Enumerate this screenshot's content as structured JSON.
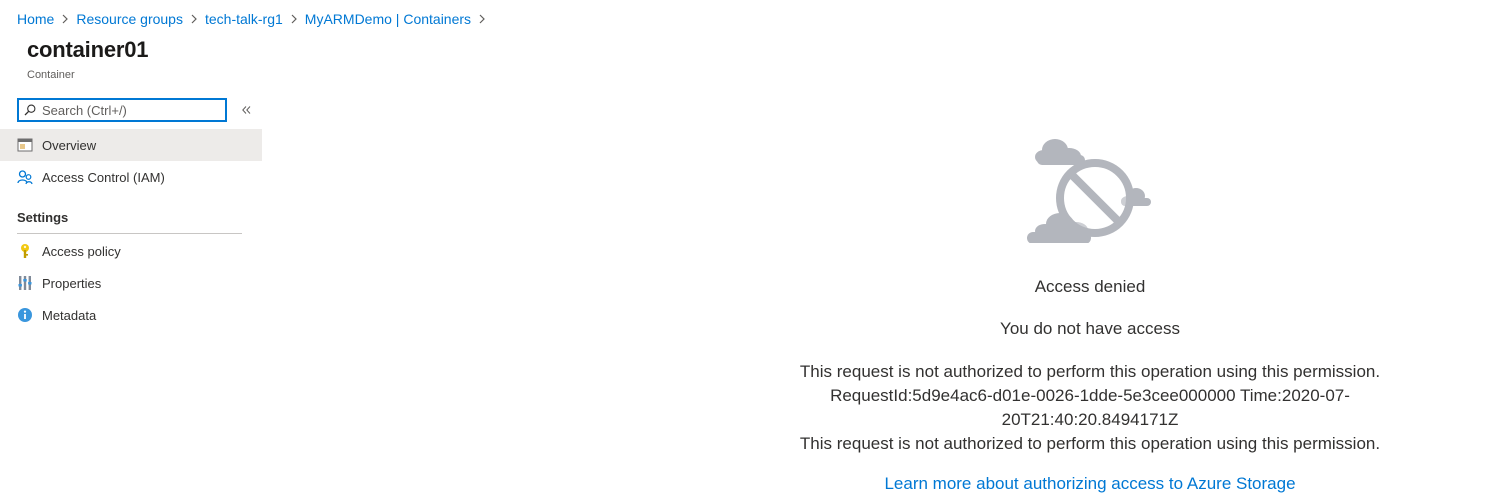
{
  "breadcrumb": [
    {
      "label": "Home"
    },
    {
      "label": "Resource groups"
    },
    {
      "label": "tech-talk-rg1"
    },
    {
      "label": "MyARMDemo | Containers"
    }
  ],
  "resource": {
    "title": "container01",
    "subtitle": "Container"
  },
  "search": {
    "placeholder": "Search (Ctrl+/)"
  },
  "sidebar": {
    "items": [
      {
        "label": "Overview",
        "icon": "overview-icon",
        "selected": true
      },
      {
        "label": "Access Control (IAM)",
        "icon": "people-icon"
      }
    ],
    "section_settings": "Settings",
    "settings_items": [
      {
        "label": "Access policy",
        "icon": "key-icon"
      },
      {
        "label": "Properties",
        "icon": "properties-icon"
      },
      {
        "label": "Metadata",
        "icon": "info-icon"
      }
    ]
  },
  "main": {
    "graphic_icon": "access-denied-cloud-icon",
    "title": "Access denied",
    "subtitle": "You do not have access",
    "detail_line1": "This request is not authorized to perform this operation using this permission.",
    "detail_line2": "RequestId:5d9e4ac6-d01e-0026-1dde-5e3cee000000 Time:2020-07-20T21:40:20.8494171Z",
    "detail_line3": "This request is not authorized to perform this operation using this permission.",
    "learn_more": "Learn more about authorizing access to Azure Storage"
  },
  "colors": {
    "accent": "#0078d4",
    "selected_bg": "#edebe9",
    "graphic_gray": "#b3b6bd",
    "key_yellow": "#f2c811"
  }
}
